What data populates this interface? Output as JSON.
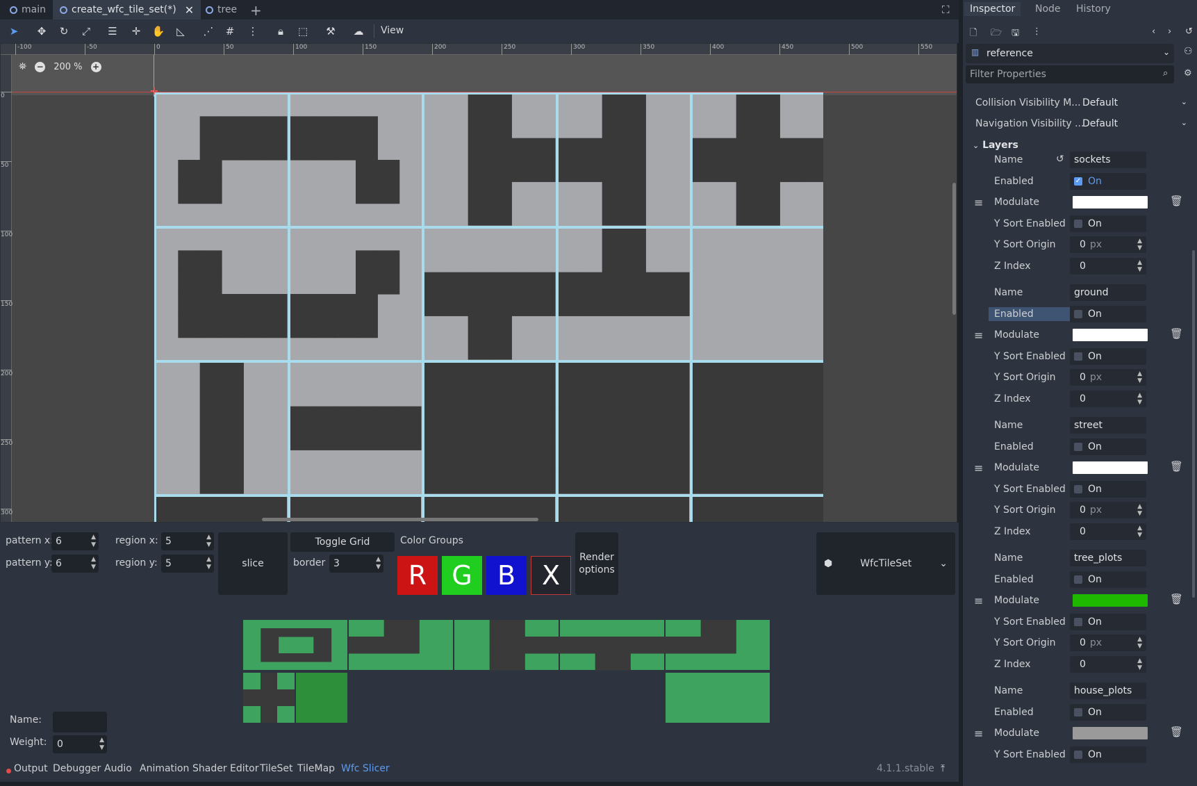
{
  "tabs": [
    {
      "label": "main",
      "active": false
    },
    {
      "label": "create_wfc_tile_set(*)",
      "active": true
    },
    {
      "label": "tree",
      "active": false
    }
  ],
  "toolbar": {
    "view_label": "View"
  },
  "viewport": {
    "zoom": "200 %",
    "ruler_top": [
      "-100",
      "-50",
      "0",
      "50",
      "100",
      "150",
      "200",
      "250",
      "300",
      "350",
      "400",
      "450",
      "500",
      "550"
    ],
    "ruler_left": [
      "0",
      "50",
      "100",
      "150",
      "200",
      "250",
      "300"
    ]
  },
  "slicer": {
    "pattern_x_label": "pattern x:",
    "pattern_x": "6",
    "pattern_y_label": "pattern y:",
    "pattern_y": "6",
    "region_x_label": "region x:",
    "region_x": "5",
    "region_y_label": "region y:",
    "region_y": "5",
    "slice_label": "slice",
    "toggle_grid_label": "Toggle Grid",
    "border_label": "border",
    "border": "3",
    "color_groups_label": "Color Groups",
    "color_groups": [
      {
        "label": "R",
        "color": "#cc1414"
      },
      {
        "label": "G",
        "color": "#1fce1f"
      },
      {
        "label": "B",
        "color": "#1111d0"
      },
      {
        "label": "X",
        "color": "#23272d"
      }
    ],
    "render_options_label": "Render options",
    "tileset_type": "WfcTileSet",
    "name_label": "Name:",
    "name_value": "",
    "weight_label": "Weight:",
    "weight_value": "0"
  },
  "bottom_tabs": [
    "Output",
    "Debugger",
    "Audio",
    "Animation",
    "Shader Editor",
    "TileSet",
    "TileMap",
    "Wfc Slicer"
  ],
  "active_bottom_tab": "Wfc Slicer",
  "version": "4.1.1.stable",
  "inspector": {
    "tabs": [
      "Inspector",
      "Node",
      "History"
    ],
    "active_tab": "Inspector",
    "object": "reference",
    "filter_placeholder": "Filter Properties",
    "properties": [
      {
        "label": "Collision Visibility M...",
        "value": "Default"
      },
      {
        "label": "Navigation Visibility ...",
        "value": "Default"
      }
    ],
    "layers_label": "Layers",
    "field_labels": {
      "name": "Name",
      "enabled": "Enabled",
      "modulate": "Modulate",
      "y_sort_enabled": "Y Sort Enabled",
      "y_sort_origin": "Y Sort Origin",
      "z_index": "Z Index",
      "on": "On",
      "px": "px"
    },
    "layers": [
      {
        "name": "sockets",
        "enabled": true,
        "modulate": "#ffffff",
        "y_sort_enabled": false,
        "y_sort_origin": "0",
        "z_index": "0"
      },
      {
        "name": "ground",
        "enabled": false,
        "modulate": "#ffffff",
        "y_sort_enabled": false,
        "y_sort_origin": "0",
        "z_index": "0"
      },
      {
        "name": "street",
        "enabled": false,
        "modulate": "#ffffff",
        "y_sort_enabled": false,
        "y_sort_origin": "0",
        "z_index": "0"
      },
      {
        "name": "tree_plots",
        "enabled": false,
        "modulate": "#1fb800",
        "y_sort_enabled": false,
        "y_sort_origin": "0",
        "z_index": "0"
      },
      {
        "name": "house_plots",
        "enabled": false,
        "modulate": "#9a9a9a",
        "y_sort_enabled": false
      }
    ]
  },
  "colors": {
    "accent": "#5d9bf0",
    "grid_line": "#a8dcec",
    "tile_light": "#a6a8ac",
    "tile_dark": "#393939",
    "road_green": "#3fa360"
  }
}
